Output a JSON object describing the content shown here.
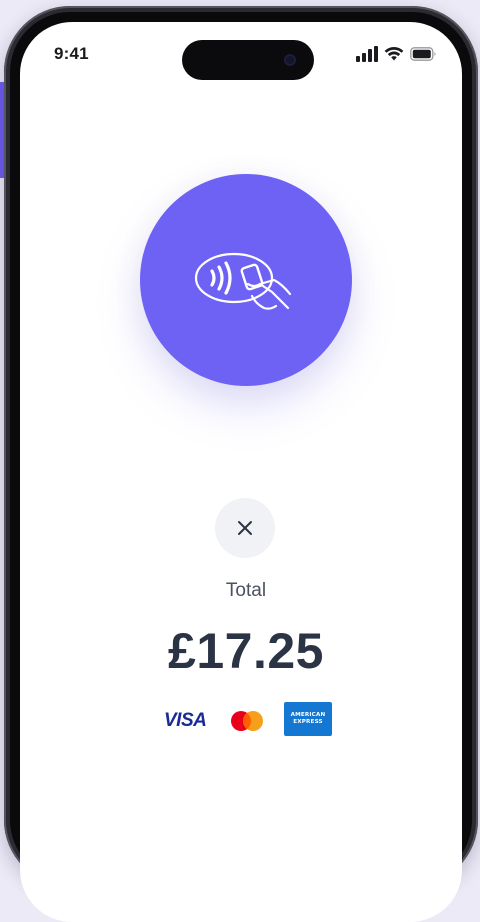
{
  "status_bar": {
    "time": "9:41",
    "icons": [
      "cellular-signal-icon",
      "wifi-icon",
      "battery-icon"
    ]
  },
  "payment": {
    "prompt_icon": "contactless-tap-icon",
    "close_icon": "close-icon",
    "total_label": "Total",
    "amount": "£17.25"
  },
  "card_brands": {
    "visa": "VISA",
    "amex_line1": "AMERICAN",
    "amex_line2": "EXPRESS"
  },
  "colors": {
    "accent": "#6e62f4",
    "amount_text": "#2b3445",
    "close_bg": "#f1f2f5",
    "visa_blue": "#1a2a96",
    "amex_blue": "#1478d2",
    "mastercard_red": "#eb001b",
    "mastercard_orange": "#f79e1b"
  }
}
